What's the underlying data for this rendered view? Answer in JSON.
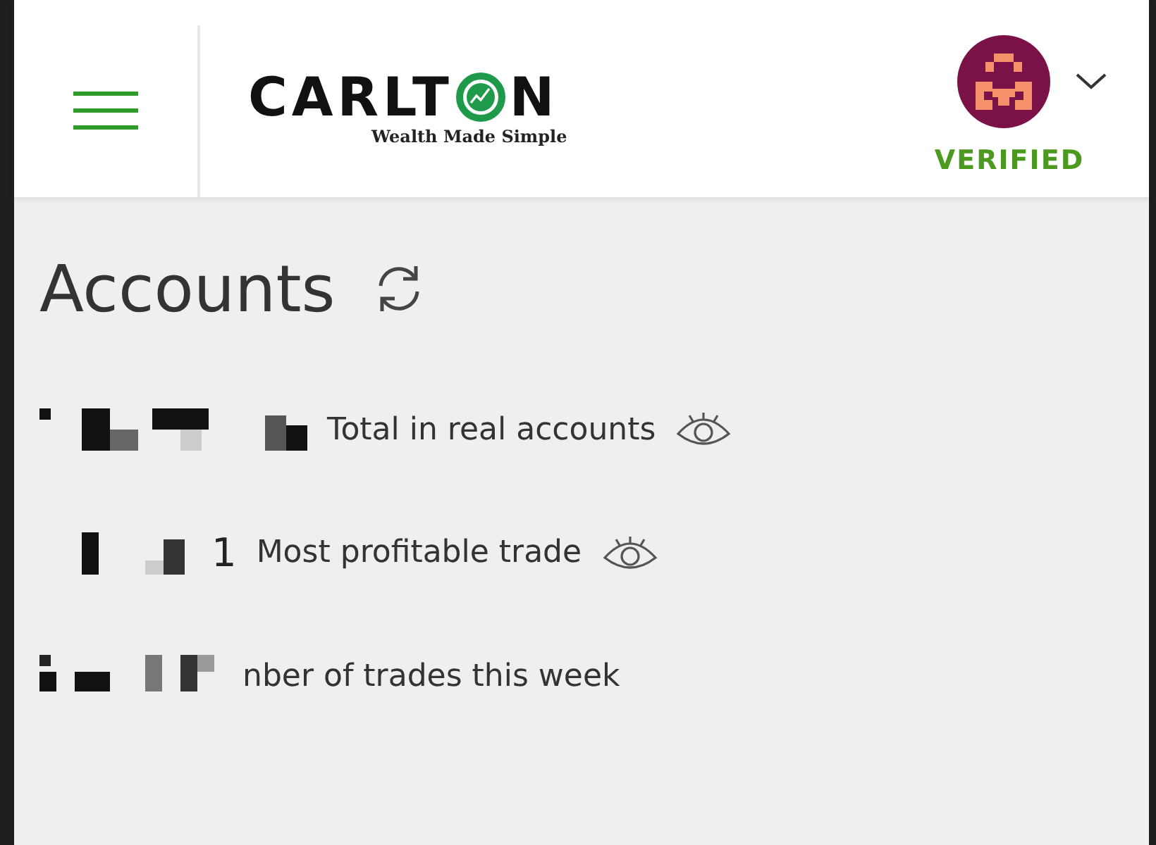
{
  "header": {
    "logo": {
      "text_before": "CARLT",
      "text_after": "N",
      "tagline": "Wealth Made Simple"
    },
    "user": {
      "status": "VERIFIED"
    }
  },
  "page": {
    "title": "Accounts"
  },
  "stats": [
    {
      "label": "Total in real accounts",
      "hidden_toggle": true
    },
    {
      "value_tail": "1",
      "label": "Most profitable trade",
      "hidden_toggle": true
    },
    {
      "label": "nber of trades this week",
      "hidden_toggle": false
    }
  ]
}
